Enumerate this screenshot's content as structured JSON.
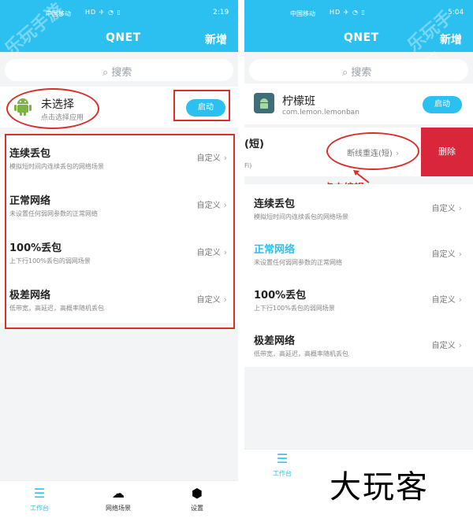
{
  "left": {
    "status": {
      "carrier": "中国移动",
      "time": "2:19",
      "icons": "HD ✈ ◔ ▯"
    },
    "title": "QNET",
    "add_label": "新增",
    "search_placeholder": "搜索",
    "app": {
      "name": "未选择",
      "sub": "点击选择应用",
      "start_label": "启动"
    },
    "scenes": [
      {
        "name": "连续丢包",
        "desc": "模拟短时间内连续丢包的网络场景",
        "edit": "自定义"
      },
      {
        "name": "正常网络",
        "desc": "未设置任何弱网参数的正常网络",
        "edit": "自定义"
      },
      {
        "name": "100%丢包",
        "desc": "上下行100%丢包的弱网场景",
        "edit": "自定义"
      },
      {
        "name": "极差网络",
        "desc": "低带宽，高延迟，高概率随机丢包",
        "edit": "自定义"
      }
    ],
    "tabs": [
      {
        "label": "工作台",
        "icon": "sliders-icon"
      },
      {
        "label": "网络场景",
        "icon": "cloud-icon"
      },
      {
        "label": "设置",
        "icon": "settings-icon"
      }
    ]
  },
  "right": {
    "status": {
      "carrier": "中国移动",
      "time": "5:04",
      "icons": "HD ✈ ◔ ▯"
    },
    "title": "QNET",
    "add_label": "新增",
    "search_placeholder": "搜索",
    "app": {
      "name": "柠檬班",
      "sub": "com.lemon.lemonban",
      "start_label": "启动"
    },
    "swiped": {
      "name_fragment": "(短)",
      "sub_fragment": "Fi)",
      "edit": "断线重连(短)",
      "delete_label": "删除"
    },
    "annotation": "点击编辑",
    "scenes": [
      {
        "name": "连续丢包",
        "desc": "模拟短时间内连续丢包的网络场景",
        "edit": "自定义"
      },
      {
        "name": "正常网络",
        "desc": "未设置任何弱网参数的正常网络",
        "edit": "自定义"
      },
      {
        "name": "100%丢包",
        "desc": "上下行100%丢包的弱网场景",
        "edit": "自定义"
      },
      {
        "name": "极差网络",
        "desc": "低带宽，高延迟，高概率随机丢包",
        "edit": "自定义"
      }
    ],
    "tabs": [
      {
        "label": "工作台"
      }
    ]
  },
  "watermark": "乐玩手游",
  "brand": "大玩客",
  "colors": {
    "accent": "#2bc0f0",
    "annotation": "#d9302c",
    "delete": "#d9263a"
  }
}
